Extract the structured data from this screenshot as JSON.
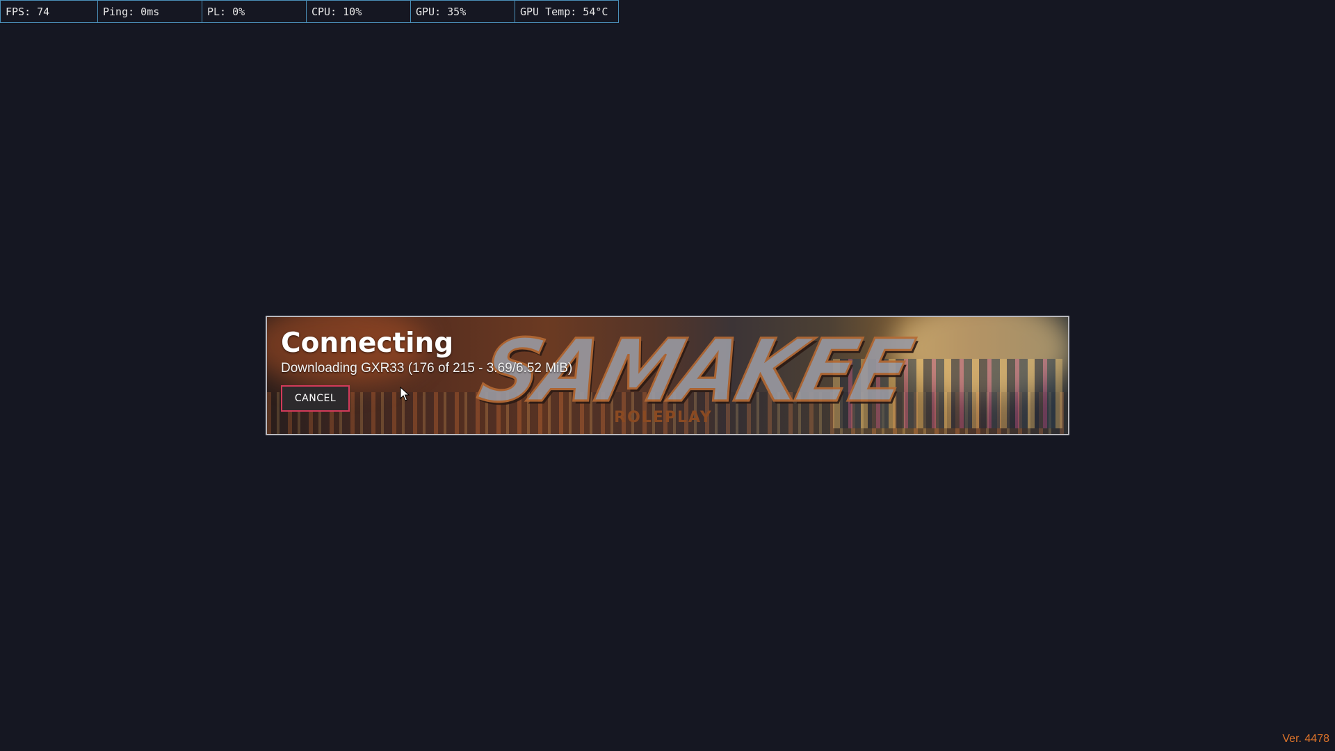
{
  "perf": {
    "fps": "FPS: 74",
    "ping": "Ping: 0ms",
    "pl": "PL: 0%",
    "cpu": "CPU: 10%",
    "gpu": "GPU: 35%",
    "gpu_temp": "GPU Temp: 54°C"
  },
  "connect": {
    "title": "Connecting",
    "status": "Downloading GXR33 (176 of 215 - 3.69/6.52 MiB)",
    "cancel_label": "CANCEL",
    "logo_text": "SAMAKEE",
    "logo_sub": "ROLEPLAY"
  },
  "footer": {
    "version": "Ver. 4478"
  },
  "colors": {
    "background": "#151722",
    "perf_border": "#4a8fb8",
    "cancel_border": "#d23a5a",
    "version_text": "#e0752a"
  },
  "icons": {
    "cursor": "mouse-pointer-icon"
  }
}
